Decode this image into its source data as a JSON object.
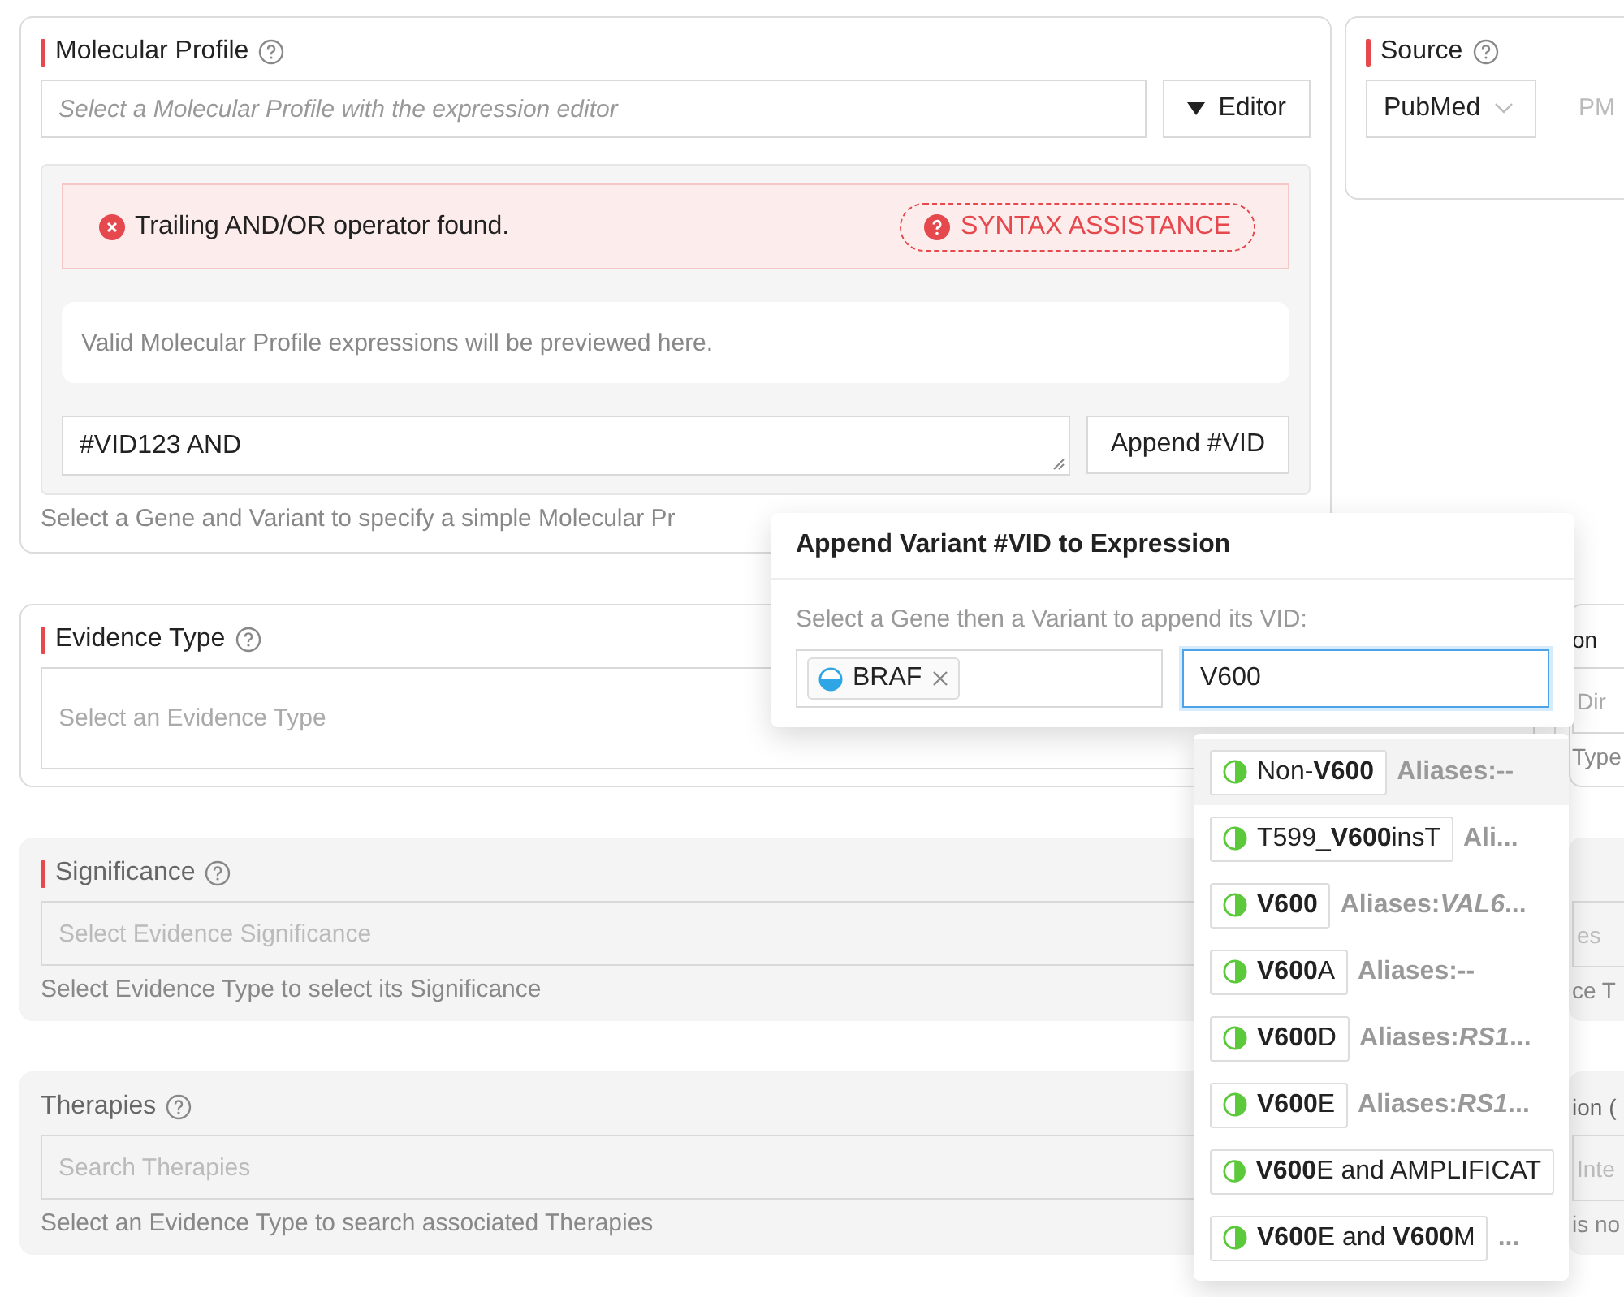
{
  "molecular_profile": {
    "label": "Molecular Profile",
    "required": true,
    "select_placeholder": "Select a Molecular Profile with the expression editor",
    "editor_button": "Editor",
    "editor_expanded": true,
    "error": "Trailing AND/OR operator found.",
    "syntax_button": "SYNTAX ASSISTANCE",
    "preview": "Valid Molecular Profile expressions will be previewed here.",
    "expression": "#VID123 AND",
    "append_button": "Append #VID",
    "help": "Select a Gene and Variant to specify a simple Molecular Pr"
  },
  "source": {
    "label": "Source",
    "required": true,
    "source_type": "PubMed",
    "id_placeholder": "PM"
  },
  "fields": [
    {
      "label": "Evidence Type",
      "required": true,
      "disabled": false,
      "placeholder": "Select an Evidence Type",
      "right": {
        "label": "on",
        "placeholder": "Dir",
        "help": "Type"
      }
    },
    {
      "label": "Significance",
      "required": true,
      "disabled": true,
      "placeholder": "Select Evidence Significance",
      "help": "Select Evidence Type to select its Significance",
      "right": {
        "placeholder": "es",
        "help": "ce T"
      }
    },
    {
      "label": "Therapies",
      "required": false,
      "disabled": true,
      "placeholder": "Search Therapies",
      "help": "Select an Evidence Type to search associated Therapies",
      "right": {
        "label": "ion (",
        "placeholder": "Inte",
        "help": "is no"
      }
    }
  ],
  "popover": {
    "title": "Append Variant #VID to Expression",
    "prompt": "Select a Gene then a Variant to append its VID:",
    "gene": "BRAF",
    "variant_query": "V600",
    "options": [
      {
        "name": "Non-**V600**",
        "aliases": "Aliases:--",
        "highlighted": true
      },
      {
        "name": "T599_**V600**insT",
        "aliases": "Ali...",
        "highlighted": false
      },
      {
        "name": "**V600**",
        "aliases": "Aliases:*VAL6*...",
        "highlighted": false
      },
      {
        "name": "**V600**A",
        "aliases": "Aliases:--",
        "highlighted": false
      },
      {
        "name": "**V600**D",
        "aliases": "Aliases:*RS1*...",
        "highlighted": false
      },
      {
        "name": "**V600**E",
        "aliases": "Aliases:*RS1*...",
        "highlighted": false
      },
      {
        "name": "**V600**E and AMPLIFICAT",
        "highlighted": false
      },
      {
        "name": "**V600**E and **V600**M",
        "aliases": "...",
        "highlighted": false
      }
    ]
  }
}
